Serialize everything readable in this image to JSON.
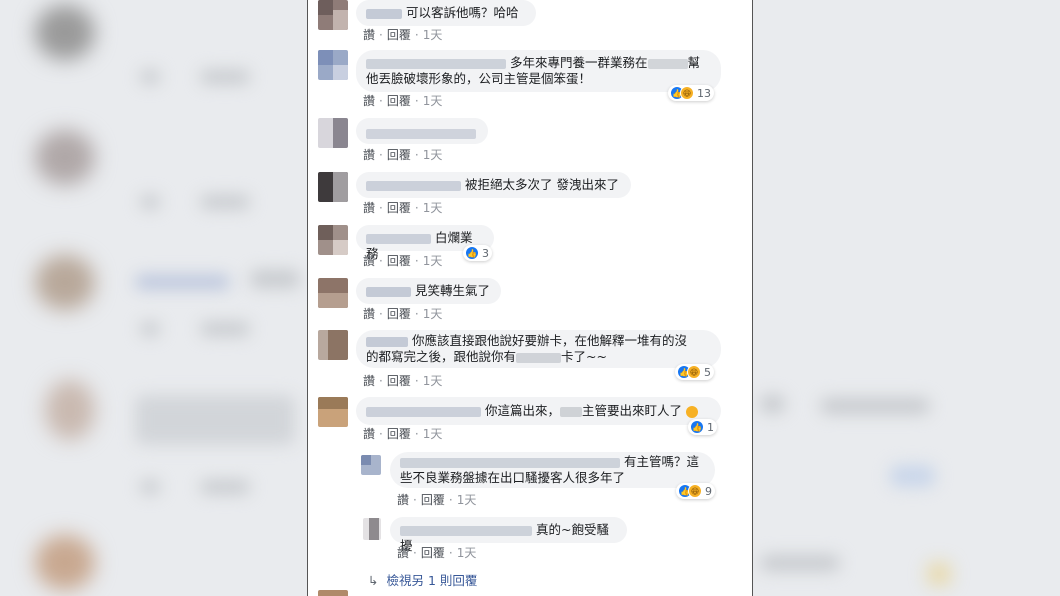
{
  "actions": {
    "like": "讚",
    "reply": "回覆",
    "dot": "·"
  },
  "comments": [
    {
      "text": "可以客訴他嗎？哈哈",
      "time": "1天"
    },
    {
      "text_line1": "多年來專門養一群業務在",
      "text_line1b": "幫",
      "text_line2": "他丟臉破壞形象的，公司主管是個笨蛋！",
      "time": "1天",
      "reactions": "13"
    },
    {
      "time": "1天"
    },
    {
      "text": "被拒絕太多次了 發洩出來了",
      "time": "1天"
    },
    {
      "text": "白爛業務",
      "time": "1天",
      "reactions": "3"
    },
    {
      "text": "見笑轉生氣了",
      "time": "1天"
    },
    {
      "text_line1": "你應該直接跟他說好要辦卡，在他解釋一堆有的沒",
      "text_line2a": "的都寫完之後，跟他說你有",
      "text_line2b": "卡了~~",
      "time": "1天",
      "reactions": "5"
    },
    {
      "text_a": "你這篇出來，",
      "text_b": "主管要出來盯人了",
      "time": "1天",
      "reactions": "1"
    }
  ],
  "replies": [
    {
      "text_line1": "有主管嗎？這",
      "text_line2": "些不良業務盤據在出口騷擾客人很多年了",
      "time": "1天",
      "reactions": "9"
    },
    {
      "text": "真的~飽受騷擾",
      "time": "1天"
    }
  ],
  "more_replies": {
    "arrow": "↳",
    "label": "檢視另 1 則回覆"
  },
  "colors": {
    "like_blue": "#1877f2",
    "haha_yellow": "#f7b125",
    "link": "#385898",
    "bubble": "#f2f3f5"
  }
}
